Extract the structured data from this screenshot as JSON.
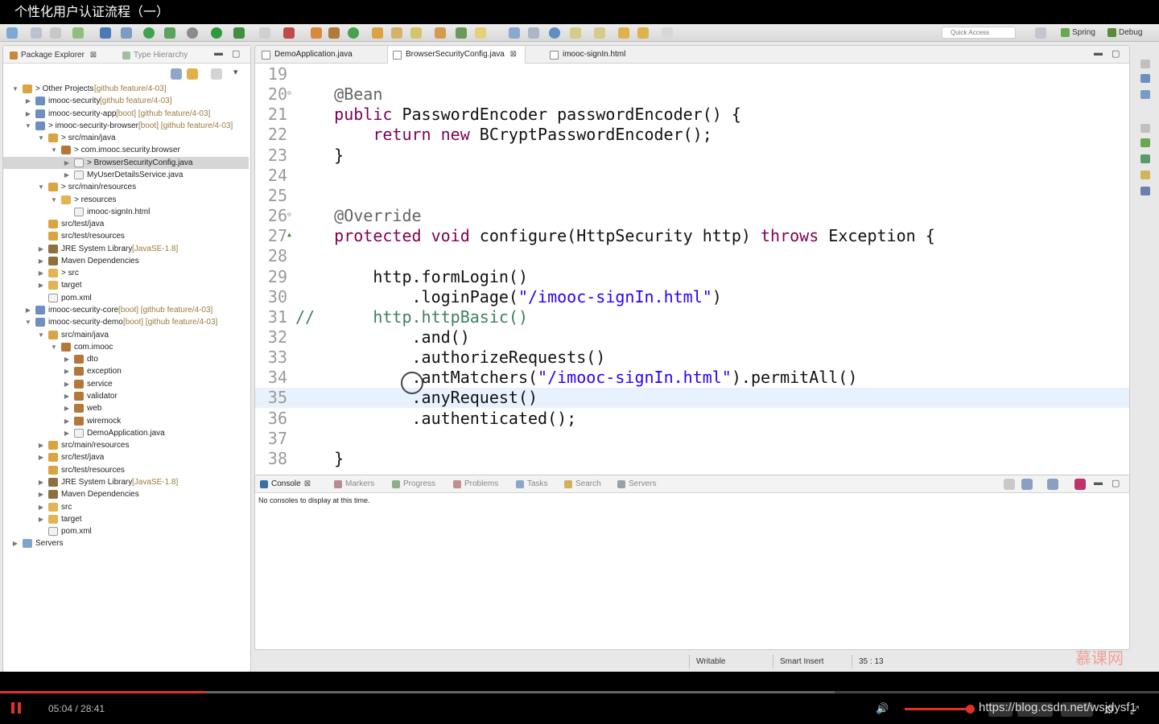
{
  "video": {
    "title": "个性化用户认证流程（一）",
    "time": "05:04 / 28:41",
    "progress_fraction": 0.177,
    "buffered_fraction": 0.72,
    "url_overlay": "https://blog.csdn.net/wsjdysf1",
    "watermark": "慕课网"
  },
  "toolbar": {
    "quick_access_placeholder": "Quick Access",
    "perspectives": [
      {
        "label": "Spring",
        "icon": "spring-leaf-icon",
        "color": "#6aa84f"
      },
      {
        "label": "Debug",
        "icon": "bug-icon",
        "color": "#5a8a3a"
      }
    ]
  },
  "package_explorer": {
    "tab_label": "Package Explorer",
    "close_glyph": "⊠",
    "hierarchy_tab_label": "Type Hierarchy",
    "rows": [
      {
        "indent": 0,
        "expanded": true,
        "icon": "working-set-icon",
        "label": "> Other Projects",
        "decor": " [github feature/4-03]"
      },
      {
        "indent": 1,
        "expanded": false,
        "icon": "project-icon",
        "label": "imooc-security",
        "decor": " [github feature/4-03]"
      },
      {
        "indent": 1,
        "expanded": false,
        "icon": "project-icon",
        "label": "imooc-security-app",
        "decor": " [boot] [github feature/4-03]"
      },
      {
        "indent": 1,
        "expanded": true,
        "icon": "project-icon",
        "label": "> imooc-security-browser",
        "decor": " [boot] [github feature/4-03]"
      },
      {
        "indent": 2,
        "expanded": true,
        "icon": "source-folder-icon",
        "label": "> src/main/java",
        "decor": ""
      },
      {
        "indent": 3,
        "expanded": true,
        "icon": "package-icon",
        "label": "> com.imooc.security.browser",
        "decor": ""
      },
      {
        "indent": 4,
        "expanded": false,
        "icon": "java-file-icon",
        "label": "> BrowserSecurityConfig.java",
        "decor": "",
        "selected": true
      },
      {
        "indent": 4,
        "expanded": false,
        "icon": "java-file-icon",
        "label": "MyUserDetailsService.java",
        "decor": ""
      },
      {
        "indent": 2,
        "expanded": true,
        "icon": "source-folder-icon",
        "label": "> src/main/resources",
        "decor": ""
      },
      {
        "indent": 3,
        "expanded": true,
        "icon": "folder-icon",
        "label": "> resources",
        "decor": ""
      },
      {
        "indent": 4,
        "expanded": null,
        "icon": "html-file-icon",
        "label": "imooc-signIn.html",
        "decor": ""
      },
      {
        "indent": 2,
        "expanded": null,
        "icon": "source-folder-icon",
        "label": "src/test/java",
        "decor": ""
      },
      {
        "indent": 2,
        "expanded": null,
        "icon": "source-folder-icon",
        "label": "src/test/resources",
        "decor": ""
      },
      {
        "indent": 2,
        "expanded": false,
        "icon": "library-icon",
        "label": "JRE System Library",
        "decor": " [JavaSE-1.8]"
      },
      {
        "indent": 2,
        "expanded": false,
        "icon": "library-icon",
        "label": "Maven Dependencies",
        "decor": ""
      },
      {
        "indent": 2,
        "expanded": false,
        "icon": "folder-icon",
        "label": "> src",
        "decor": ""
      },
      {
        "indent": 2,
        "expanded": false,
        "icon": "folder-icon",
        "label": "target",
        "decor": ""
      },
      {
        "indent": 2,
        "expanded": null,
        "icon": "xml-file-icon",
        "label": "pom.xml",
        "decor": ""
      },
      {
        "indent": 1,
        "expanded": false,
        "icon": "project-icon",
        "label": "imooc-security-core",
        "decor": " [boot] [github feature/4-03]"
      },
      {
        "indent": 1,
        "expanded": true,
        "icon": "project-icon",
        "label": "imooc-security-demo",
        "decor": " [boot] [github feature/4-03]"
      },
      {
        "indent": 2,
        "expanded": true,
        "icon": "source-folder-icon",
        "label": "src/main/java",
        "decor": ""
      },
      {
        "indent": 3,
        "expanded": true,
        "icon": "package-icon",
        "label": "com.imooc",
        "decor": ""
      },
      {
        "indent": 4,
        "expanded": false,
        "icon": "package-icon",
        "label": "dto",
        "decor": ""
      },
      {
        "indent": 4,
        "expanded": false,
        "icon": "package-icon",
        "label": "exception",
        "decor": ""
      },
      {
        "indent": 4,
        "expanded": false,
        "icon": "package-icon",
        "label": "service",
        "decor": ""
      },
      {
        "indent": 4,
        "expanded": false,
        "icon": "package-icon",
        "label": "validator",
        "decor": ""
      },
      {
        "indent": 4,
        "expanded": false,
        "icon": "package-icon",
        "label": "web",
        "decor": ""
      },
      {
        "indent": 4,
        "expanded": false,
        "icon": "package-icon",
        "label": "wiremock",
        "decor": ""
      },
      {
        "indent": 4,
        "expanded": false,
        "icon": "java-file-icon",
        "label": "DemoApplication.java",
        "decor": ""
      },
      {
        "indent": 2,
        "expanded": false,
        "icon": "source-folder-icon",
        "label": "src/main/resources",
        "decor": ""
      },
      {
        "indent": 2,
        "expanded": false,
        "icon": "source-folder-icon",
        "label": "src/test/java",
        "decor": ""
      },
      {
        "indent": 2,
        "expanded": null,
        "icon": "source-folder-icon",
        "label": "src/test/resources",
        "decor": ""
      },
      {
        "indent": 2,
        "expanded": false,
        "icon": "library-icon",
        "label": "JRE System Library",
        "decor": " [JavaSE-1.8]"
      },
      {
        "indent": 2,
        "expanded": false,
        "icon": "library-icon",
        "label": "Maven Dependencies",
        "decor": ""
      },
      {
        "indent": 2,
        "expanded": false,
        "icon": "folder-icon",
        "label": "src",
        "decor": ""
      },
      {
        "indent": 2,
        "expanded": false,
        "icon": "folder-icon",
        "label": "target",
        "decor": ""
      },
      {
        "indent": 2,
        "expanded": null,
        "icon": "xml-file-icon",
        "label": "pom.xml",
        "decor": ""
      },
      {
        "indent": 0,
        "expanded": false,
        "icon": "servers-folder-icon",
        "label": "Servers",
        "decor": ""
      }
    ]
  },
  "editor": {
    "tabs": [
      {
        "label": "DemoApplication.java",
        "active": false
      },
      {
        "label": "BrowserSecurityConfig.java",
        "active": true,
        "close": "⊠"
      },
      {
        "label": "imooc-signIn.html",
        "active": false
      }
    ],
    "current_line": 35,
    "lines": [
      {
        "n": "19",
        "tokens": []
      },
      {
        "n": "20",
        "marker": "⊖",
        "tokens": [
          [
            "ann",
            "    @Bean"
          ]
        ]
      },
      {
        "n": "21",
        "tokens": [
          [
            "kw",
            "    public "
          ],
          [
            "",
            "PasswordEncoder passwordEncoder() {"
          ]
        ]
      },
      {
        "n": "22",
        "tokens": [
          [
            "kw",
            "        return new "
          ],
          [
            "",
            "BCryptPasswordEncoder();"
          ]
        ]
      },
      {
        "n": "23",
        "tokens": [
          [
            "",
            "    }"
          ]
        ]
      },
      {
        "n": "24",
        "tokens": []
      },
      {
        "n": "25",
        "tokens": []
      },
      {
        "n": "26",
        "marker": "⊖",
        "tokens": [
          [
            "ann",
            "    @Override"
          ]
        ]
      },
      {
        "n": "27",
        "marker": "▲",
        "tokens": [
          [
            "kw",
            "    protected void "
          ],
          [
            "",
            "configure(HttpSecurity http) "
          ],
          [
            "kw",
            "throws "
          ],
          [
            "",
            "Exception {"
          ]
        ]
      },
      {
        "n": "28",
        "tokens": []
      },
      {
        "n": "29",
        "tokens": [
          [
            "",
            "        http.formLogin()"
          ]
        ]
      },
      {
        "n": "30",
        "tokens": [
          [
            "",
            "            .loginPage("
          ],
          [
            "str",
            "\"/imooc-signIn.html\""
          ],
          [
            "",
            ")"
          ]
        ]
      },
      {
        "n": "31",
        "tokens": [
          [
            "cmt",
            "//      http.httpBasic()"
          ]
        ]
      },
      {
        "n": "32",
        "tokens": [
          [
            "",
            "            .and()"
          ]
        ]
      },
      {
        "n": "33",
        "tokens": [
          [
            "",
            "            .authorizeRequests()"
          ]
        ]
      },
      {
        "n": "34",
        "tokens": [
          [
            "",
            "            .antMatchers("
          ],
          [
            "str",
            "\"/imooc-signIn.html\""
          ],
          [
            "",
            ").permitAll()"
          ]
        ]
      },
      {
        "n": "35",
        "tokens": [
          [
            "",
            "            .anyRequest()"
          ]
        ]
      },
      {
        "n": "36",
        "tokens": [
          [
            "",
            "            .authenticated();"
          ]
        ]
      },
      {
        "n": "37",
        "tokens": []
      },
      {
        "n": "38",
        "tokens": [
          [
            "",
            "    }"
          ]
        ]
      }
    ]
  },
  "console": {
    "tabs": [
      {
        "label": "Console",
        "active": true,
        "icon": "console-icon",
        "color": "#3b6ea5"
      },
      {
        "label": "Markers",
        "active": false,
        "icon": "markers-icon",
        "color": "#b98b8b"
      },
      {
        "label": "Progress",
        "active": false,
        "icon": "progress-icon",
        "color": "#8ab08a"
      },
      {
        "label": "Problems",
        "active": false,
        "icon": "problems-icon",
        "color": "#c28f8f"
      },
      {
        "label": "Tasks",
        "active": false,
        "icon": "tasks-icon",
        "color": "#8aa7c8"
      },
      {
        "label": "Search",
        "active": false,
        "icon": "search-icon",
        "color": "#d2b15a"
      },
      {
        "label": "Servers",
        "active": false,
        "icon": "servers-icon",
        "color": "#9aa0a8"
      }
    ],
    "close_glyph": "⊠",
    "message": "No consoles to display at this time."
  },
  "status": {
    "writable": "Writable",
    "insert_mode": "Smart Insert",
    "position": "35 : 13"
  },
  "colors": {
    "keyword": "#7f0055",
    "annotation": "#646464",
    "string": "#2a00ff",
    "comment": "#3f7f5f",
    "progress": "#e03228"
  }
}
